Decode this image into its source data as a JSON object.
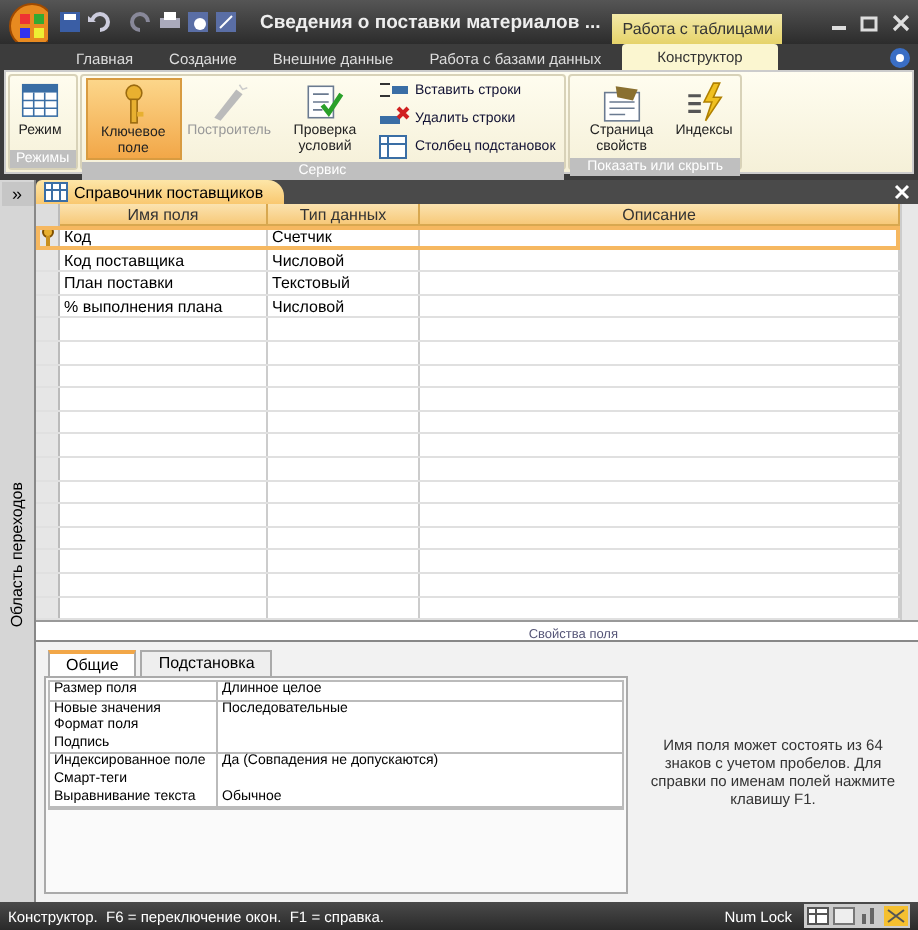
{
  "window": {
    "title": "Сведения о поставки материалов ...",
    "context_tab": "Работа с таблицами"
  },
  "ribbon_tabs": [
    {
      "label": "Главная",
      "selected": false
    },
    {
      "label": "Создание",
      "selected": false
    },
    {
      "label": "Внешние данные",
      "selected": false
    },
    {
      "label": "Работа с базами данных",
      "selected": false
    },
    {
      "label": "Конструктор",
      "selected": true
    }
  ],
  "ribbon_groups": [
    {
      "label": "Режимы",
      "items": [
        {
          "kind": "big",
          "label": "Режим",
          "selected": false,
          "disabled": false
        }
      ]
    },
    {
      "label": "Сервис",
      "items": [
        {
          "kind": "big",
          "label": "Ключевое поле",
          "selected": true,
          "disabled": false
        },
        {
          "kind": "big",
          "label": "Построитель",
          "selected": false,
          "disabled": true
        },
        {
          "kind": "big",
          "label": "Проверка условий",
          "selected": false,
          "disabled": false
        },
        {
          "kind": "small",
          "label": "Вставить строки",
          "disabled": false
        },
        {
          "kind": "small",
          "label": "Удалить строки",
          "disabled": false
        },
        {
          "kind": "small",
          "label": "Столбец подстановок",
          "disabled": false
        }
      ]
    },
    {
      "label": "Показать или скрыть",
      "items": [
        {
          "kind": "big",
          "label": "Страница свойств",
          "selected": false,
          "disabled": false
        },
        {
          "kind": "big",
          "label": "Индексы",
          "selected": false,
          "disabled": false
        }
      ]
    }
  ],
  "nav_pane": {
    "button": "»",
    "label": "Область переходов"
  },
  "document_tab": {
    "label": "Справочник поставщиков"
  },
  "table": {
    "columns": [
      "Имя поля",
      "Тип данных",
      "Описание"
    ],
    "rows": [
      {
        "name": "Код",
        "type": "Счетчик",
        "primary_key": true,
        "selected": true
      },
      {
        "name": "Код поставщика",
        "type": "Числовой",
        "primary_key": false,
        "selected": false
      },
      {
        "name": "План поставки",
        "type": "Текстовый",
        "primary_key": false,
        "selected": false
      },
      {
        "name": "% выполнения плана",
        "type": "Числовой",
        "primary_key": false,
        "selected": false
      }
    ]
  },
  "field_properties": {
    "title": "Свойства поля",
    "tabs": [
      {
        "label": "Общие",
        "selected": true
      },
      {
        "label": "Подстановка",
        "selected": false
      }
    ],
    "groups": [
      [
        {
          "name": "Размер поля",
          "value": "Длинное целое"
        }
      ],
      [
        {
          "name": "Новые значения",
          "value": "Последовательные"
        },
        {
          "name": "Формат поля"
        },
        {
          "name": "Подпись"
        }
      ],
      [
        {
          "name": "Индексированное поле",
          "value": "Да (Совпадения не допускаются)"
        },
        {
          "name": "Смарт-теги"
        },
        {
          "name": "Выравнивание текста",
          "value": "Обычное"
        }
      ]
    ],
    "help": "Имя поля может состоять из 64 знаков с учетом пробелов. Для справки по именам полей нажмите клавишу F1."
  },
  "status_bar": {
    "text": "Конструктор.  F6 = переключение окон.  F1 = справка.",
    "indicator": "Num Lock"
  }
}
